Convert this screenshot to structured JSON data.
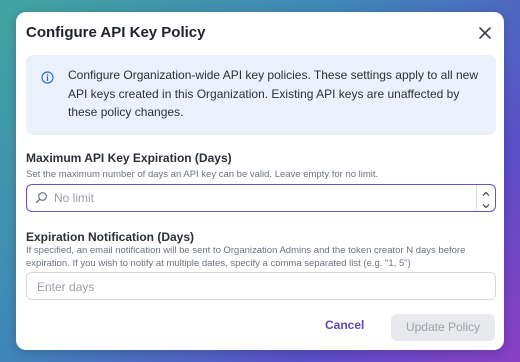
{
  "dialog": {
    "title": "Configure API Key Policy",
    "info": "Configure Organization-wide API key policies. These settings apply to all new API keys created in this Organization. Existing API keys are unaffected by these policy changes."
  },
  "max_expiration": {
    "label": "Maximum API Key Expiration (Days)",
    "help": "Set the maximum number of days an API key can be valid. Leave empty for no limit.",
    "placeholder": "No limit",
    "value": ""
  },
  "notification": {
    "label": "Expiration Notification (Days)",
    "help": "If specified, an email notification will be sent to Organization Admins and the token creator N days before expiration. If you wish to notify at multiple dates, specify a comma separated list (e.g. \"1, 5\")",
    "placeholder": "Enter days",
    "value": ""
  },
  "actions": {
    "cancel": "Cancel",
    "update": "Update Policy"
  },
  "colors": {
    "accent": "#5b4ab5",
    "info_bg": "#eaf1fb",
    "disabled_bg": "#e7e9ed"
  }
}
